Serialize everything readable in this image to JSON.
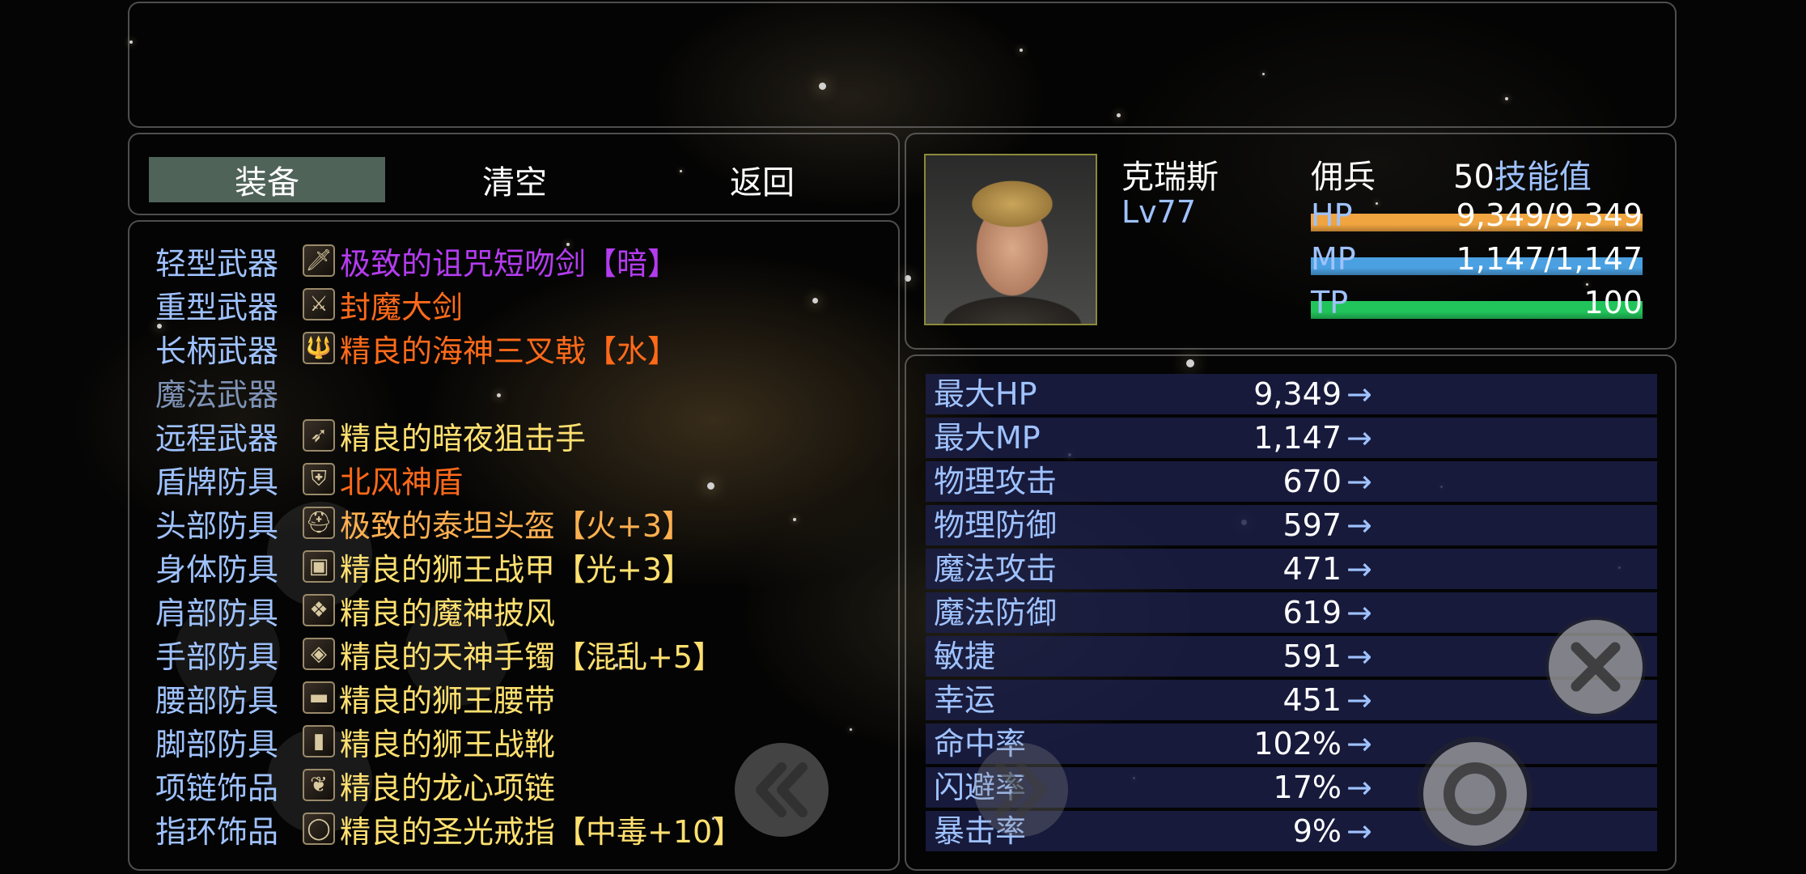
{
  "commands": [
    "装备",
    "清空",
    "返回"
  ],
  "character": {
    "name": "克瑞斯",
    "class": "佣兵",
    "level": "Lv77",
    "skill_points": "50",
    "skill_points_label": "技能值",
    "hp_label": "HP",
    "hp_value": "9,349/9,349",
    "mp_label": "MP",
    "mp_value": "1,147/1,147",
    "tp_label": "TP",
    "tp_value": "100",
    "colors": {
      "hp": "#f0a540",
      "mp": "#4aa0e0",
      "tp": "#21c45a"
    }
  },
  "equipment": [
    {
      "slot": "轻型武器",
      "icon": "dagger-icon",
      "name": "极致的诅咒短吻剑【暗】",
      "color": "#b43cf0"
    },
    {
      "slot": "重型武器",
      "icon": "greatsword-icon",
      "name": "封魔大剑",
      "color": "#ff6a1a"
    },
    {
      "slot": "长柄武器",
      "icon": "trident-icon",
      "name": "精良的海神三叉戟【水】",
      "color": "#ff6a1a"
    },
    {
      "slot": "魔法武器",
      "icon": "",
      "name": "",
      "color": "#ffffff"
    },
    {
      "slot": "远程武器",
      "icon": "sniper-rifle-icon",
      "name": "精良的暗夜狙击手",
      "color": "#ffe070"
    },
    {
      "slot": "盾牌防具",
      "icon": "shield-icon",
      "name": "北风神盾",
      "color": "#ff6a1a"
    },
    {
      "slot": "头部防具",
      "icon": "helmet-icon",
      "name": "极致的泰坦头盔【火+3】",
      "color": "#ffb050"
    },
    {
      "slot": "身体防具",
      "icon": "armor-icon",
      "name": "精良的狮王战甲【光+3】",
      "color": "#ffe070"
    },
    {
      "slot": "肩部防具",
      "icon": "cloak-icon",
      "name": "精良的魔神披风",
      "color": "#ffe070"
    },
    {
      "slot": "手部防具",
      "icon": "bracelet-icon",
      "name": "精良的天神手镯【混乱+5】",
      "color": "#ffe070"
    },
    {
      "slot": "腰部防具",
      "icon": "belt-icon",
      "name": "精良的狮王腰带",
      "color": "#ffe070"
    },
    {
      "slot": "脚部防具",
      "icon": "boots-icon",
      "name": "精良的狮王战靴",
      "color": "#ffe070"
    },
    {
      "slot": "项链饰品",
      "icon": "necklace-icon",
      "name": "精良的龙心项链",
      "color": "#ffe070"
    },
    {
      "slot": "指环饰品",
      "icon": "ring-icon",
      "name": "精良的圣光戒指【中毒+10】",
      "color": "#ffe070"
    }
  ],
  "stats": [
    {
      "name": "最大HP",
      "value": "9,349",
      "arrow": "→"
    },
    {
      "name": "最大MP",
      "value": "1,147",
      "arrow": "→"
    },
    {
      "name": "物理攻击",
      "value": "670",
      "arrow": "→"
    },
    {
      "name": "物理防御",
      "value": "597",
      "arrow": "→"
    },
    {
      "name": "魔法攻击",
      "value": "471",
      "arrow": "→"
    },
    {
      "name": "魔法防御",
      "value": "619",
      "arrow": "→"
    },
    {
      "name": "敏捷",
      "value": "591",
      "arrow": "→"
    },
    {
      "name": "幸运",
      "value": "451",
      "arrow": "→"
    },
    {
      "name": "命中率",
      "value": "102%",
      "arrow": "→"
    },
    {
      "name": "闪避率",
      "value": "17%",
      "arrow": "→"
    },
    {
      "name": "暴击率",
      "value": "9%",
      "arrow": "→"
    }
  ],
  "touch_controls": {
    "cancel_icon": "close-icon",
    "confirm_icon": "circle-icon",
    "prev_icon": "double-chevron-left-icon",
    "next_icon": "double-chevron-right-icon"
  }
}
